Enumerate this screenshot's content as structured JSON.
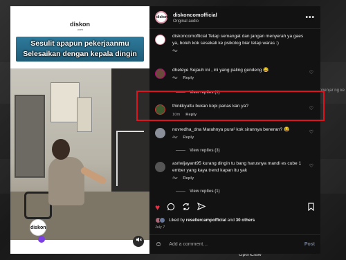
{
  "background": {
    "text_left": "OpenClaw",
    "text_right": "ppenjar ng ke"
  },
  "media": {
    "brand_name": "diskon",
    "brand_domain": ".com",
    "caption_line1": "Sesulit apapun pekerjaanmu",
    "caption_line2": "Selesaikan dengan kepala dingin",
    "corner_logo": "diskon",
    "mute_icon": "speaker-muted-icon"
  },
  "header": {
    "avatar_text": "diskon",
    "username": "diskoncomofficial",
    "subtitle": "Original audio",
    "more_icon": "•••"
  },
  "comments": [
    {
      "user": "diskoncomofficial",
      "text": "Tetap semangat dan jangan menyerah ya gaes ya, boleh kok sesekali ke psikolog biar tetap waras :)",
      "time": "4w",
      "reply": "",
      "color": "#ffffff"
    },
    {
      "user": "dheteye",
      "text": "Sejauh ini , ini yang paling gendeng 😂",
      "time": "4w",
      "reply": "Reply",
      "color": "#6a4b3b",
      "view_replies": "View replies (1)"
    },
    {
      "user": "thinkkyu",
      "text": "Itu bukan kopi panas kan ya?",
      "time": "10m",
      "reply": "Reply",
      "color": "#3d5a2e"
    },
    {
      "user": "novredha_dna",
      "text": "Marahnya pura² kok sirannya beneran? 😂",
      "time": "4w",
      "reply": "Reply",
      "color": "#8a8f99",
      "view_replies": "View replies (3)"
    },
    {
      "user": "asriwijayant95",
      "text": "kurang dingin tu bang harusnya mandi es cube 1 ember yang kaya trend kapan itu yak",
      "time": "4w",
      "reply": "Reply",
      "color": "#555555",
      "view_replies": "View replies (1)"
    }
  ],
  "actions": {
    "like_icon": "♥",
    "comment_icon": "◯",
    "share_icon": "↻",
    "send_icon": "➤",
    "save_icon": "⎕"
  },
  "likes": {
    "prefix": "Liked by",
    "user": "resellercampofficial",
    "and": "and",
    "count": "30 others"
  },
  "date": "July 7",
  "add_comment": {
    "emoji_icon": "☺",
    "placeholder": "Add a comment…",
    "post_label": "Post"
  }
}
